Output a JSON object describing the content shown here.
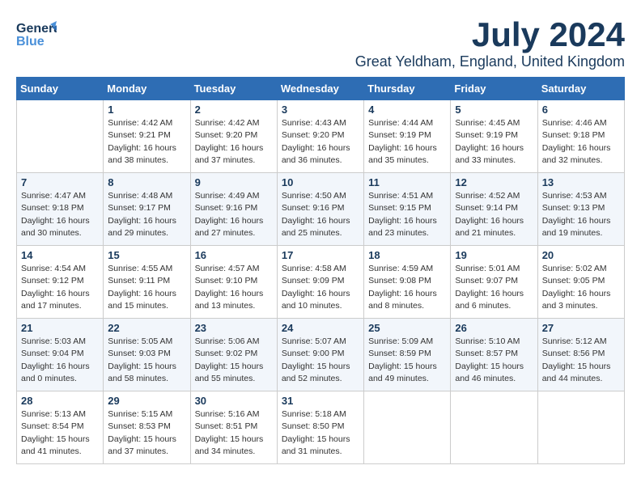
{
  "header": {
    "logo_general": "General",
    "logo_blue": "Blue",
    "month_title": "July 2024",
    "location": "Great Yeldham, England, United Kingdom"
  },
  "calendar": {
    "days_of_week": [
      "Sunday",
      "Monday",
      "Tuesday",
      "Wednesday",
      "Thursday",
      "Friday",
      "Saturday"
    ],
    "weeks": [
      [
        {
          "date": "",
          "sunrise": "",
          "sunset": "",
          "daylight": ""
        },
        {
          "date": "1",
          "sunrise": "Sunrise: 4:42 AM",
          "sunset": "Sunset: 9:21 PM",
          "daylight": "Daylight: 16 hours and 38 minutes."
        },
        {
          "date": "2",
          "sunrise": "Sunrise: 4:42 AM",
          "sunset": "Sunset: 9:20 PM",
          "daylight": "Daylight: 16 hours and 37 minutes."
        },
        {
          "date": "3",
          "sunrise": "Sunrise: 4:43 AM",
          "sunset": "Sunset: 9:20 PM",
          "daylight": "Daylight: 16 hours and 36 minutes."
        },
        {
          "date": "4",
          "sunrise": "Sunrise: 4:44 AM",
          "sunset": "Sunset: 9:19 PM",
          "daylight": "Daylight: 16 hours and 35 minutes."
        },
        {
          "date": "5",
          "sunrise": "Sunrise: 4:45 AM",
          "sunset": "Sunset: 9:19 PM",
          "daylight": "Daylight: 16 hours and 33 minutes."
        },
        {
          "date": "6",
          "sunrise": "Sunrise: 4:46 AM",
          "sunset": "Sunset: 9:18 PM",
          "daylight": "Daylight: 16 hours and 32 minutes."
        }
      ],
      [
        {
          "date": "7",
          "sunrise": "Sunrise: 4:47 AM",
          "sunset": "Sunset: 9:18 PM",
          "daylight": "Daylight: 16 hours and 30 minutes."
        },
        {
          "date": "8",
          "sunrise": "Sunrise: 4:48 AM",
          "sunset": "Sunset: 9:17 PM",
          "daylight": "Daylight: 16 hours and 29 minutes."
        },
        {
          "date": "9",
          "sunrise": "Sunrise: 4:49 AM",
          "sunset": "Sunset: 9:16 PM",
          "daylight": "Daylight: 16 hours and 27 minutes."
        },
        {
          "date": "10",
          "sunrise": "Sunrise: 4:50 AM",
          "sunset": "Sunset: 9:16 PM",
          "daylight": "Daylight: 16 hours and 25 minutes."
        },
        {
          "date": "11",
          "sunrise": "Sunrise: 4:51 AM",
          "sunset": "Sunset: 9:15 PM",
          "daylight": "Daylight: 16 hours and 23 minutes."
        },
        {
          "date": "12",
          "sunrise": "Sunrise: 4:52 AM",
          "sunset": "Sunset: 9:14 PM",
          "daylight": "Daylight: 16 hours and 21 minutes."
        },
        {
          "date": "13",
          "sunrise": "Sunrise: 4:53 AM",
          "sunset": "Sunset: 9:13 PM",
          "daylight": "Daylight: 16 hours and 19 minutes."
        }
      ],
      [
        {
          "date": "14",
          "sunrise": "Sunrise: 4:54 AM",
          "sunset": "Sunset: 9:12 PM",
          "daylight": "Daylight: 16 hours and 17 minutes."
        },
        {
          "date": "15",
          "sunrise": "Sunrise: 4:55 AM",
          "sunset": "Sunset: 9:11 PM",
          "daylight": "Daylight: 16 hours and 15 minutes."
        },
        {
          "date": "16",
          "sunrise": "Sunrise: 4:57 AM",
          "sunset": "Sunset: 9:10 PM",
          "daylight": "Daylight: 16 hours and 13 minutes."
        },
        {
          "date": "17",
          "sunrise": "Sunrise: 4:58 AM",
          "sunset": "Sunset: 9:09 PM",
          "daylight": "Daylight: 16 hours and 10 minutes."
        },
        {
          "date": "18",
          "sunrise": "Sunrise: 4:59 AM",
          "sunset": "Sunset: 9:08 PM",
          "daylight": "Daylight: 16 hours and 8 minutes."
        },
        {
          "date": "19",
          "sunrise": "Sunrise: 5:01 AM",
          "sunset": "Sunset: 9:07 PM",
          "daylight": "Daylight: 16 hours and 6 minutes."
        },
        {
          "date": "20",
          "sunrise": "Sunrise: 5:02 AM",
          "sunset": "Sunset: 9:05 PM",
          "daylight": "Daylight: 16 hours and 3 minutes."
        }
      ],
      [
        {
          "date": "21",
          "sunrise": "Sunrise: 5:03 AM",
          "sunset": "Sunset: 9:04 PM",
          "daylight": "Daylight: 16 hours and 0 minutes."
        },
        {
          "date": "22",
          "sunrise": "Sunrise: 5:05 AM",
          "sunset": "Sunset: 9:03 PM",
          "daylight": "Daylight: 15 hours and 58 minutes."
        },
        {
          "date": "23",
          "sunrise": "Sunrise: 5:06 AM",
          "sunset": "Sunset: 9:02 PM",
          "daylight": "Daylight: 15 hours and 55 minutes."
        },
        {
          "date": "24",
          "sunrise": "Sunrise: 5:07 AM",
          "sunset": "Sunset: 9:00 PM",
          "daylight": "Daylight: 15 hours and 52 minutes."
        },
        {
          "date": "25",
          "sunrise": "Sunrise: 5:09 AM",
          "sunset": "Sunset: 8:59 PM",
          "daylight": "Daylight: 15 hours and 49 minutes."
        },
        {
          "date": "26",
          "sunrise": "Sunrise: 5:10 AM",
          "sunset": "Sunset: 8:57 PM",
          "daylight": "Daylight: 15 hours and 46 minutes."
        },
        {
          "date": "27",
          "sunrise": "Sunrise: 5:12 AM",
          "sunset": "Sunset: 8:56 PM",
          "daylight": "Daylight: 15 hours and 44 minutes."
        }
      ],
      [
        {
          "date": "28",
          "sunrise": "Sunrise: 5:13 AM",
          "sunset": "Sunset: 8:54 PM",
          "daylight": "Daylight: 15 hours and 41 minutes."
        },
        {
          "date": "29",
          "sunrise": "Sunrise: 5:15 AM",
          "sunset": "Sunset: 8:53 PM",
          "daylight": "Daylight: 15 hours and 37 minutes."
        },
        {
          "date": "30",
          "sunrise": "Sunrise: 5:16 AM",
          "sunset": "Sunset: 8:51 PM",
          "daylight": "Daylight: 15 hours and 34 minutes."
        },
        {
          "date": "31",
          "sunrise": "Sunrise: 5:18 AM",
          "sunset": "Sunset: 8:50 PM",
          "daylight": "Daylight: 15 hours and 31 minutes."
        },
        {
          "date": "",
          "sunrise": "",
          "sunset": "",
          "daylight": ""
        },
        {
          "date": "",
          "sunrise": "",
          "sunset": "",
          "daylight": ""
        },
        {
          "date": "",
          "sunrise": "",
          "sunset": "",
          "daylight": ""
        }
      ]
    ]
  }
}
